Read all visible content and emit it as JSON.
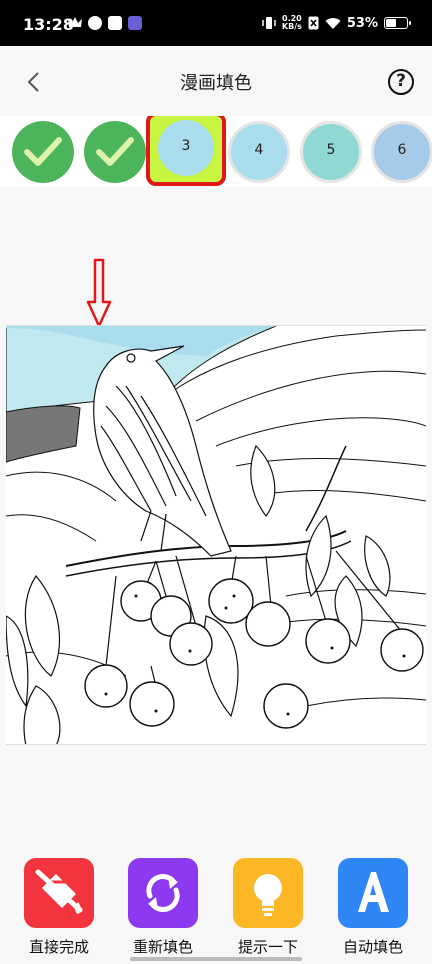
{
  "status_bar": {
    "time": "13:28",
    "speed_value": "0.20",
    "speed_unit": "KB/s",
    "battery_percent": "53%",
    "battery_level": 0.53
  },
  "header": {
    "title": "漫画填色",
    "back_icon": "chevron-left-icon",
    "help_label": "?"
  },
  "palette": {
    "swatches": [
      {
        "state": "done",
        "color": "#4cb45a"
      },
      {
        "state": "done",
        "color": "#4cb45a"
      },
      {
        "state": "selected",
        "label": "3",
        "color": "#a9dced"
      },
      {
        "state": "pending",
        "label": "4",
        "color": "#a9dced"
      },
      {
        "state": "pending",
        "label": "5",
        "color": "#8fd8d4"
      },
      {
        "state": "pending",
        "label": "6",
        "color": "#a6cbe9"
      }
    ]
  },
  "colors": {
    "accent_red": "#e01818",
    "selected_highlight": "#c8f542",
    "sky_light": "#bfe8ef",
    "sky_blue": "#a9dced"
  },
  "toolbar": {
    "items": [
      {
        "label": "直接完成",
        "icon": "paint-bucket-icon",
        "color": "#f2343e"
      },
      {
        "label": "重新填色",
        "icon": "refresh-icon",
        "color": "#8c39f0"
      },
      {
        "label": "提示一下",
        "icon": "lightbulb-icon",
        "color": "#fbb726"
      },
      {
        "label": "自动填色",
        "icon": "letter-a-icon",
        "color": "#2f86f6"
      }
    ]
  }
}
